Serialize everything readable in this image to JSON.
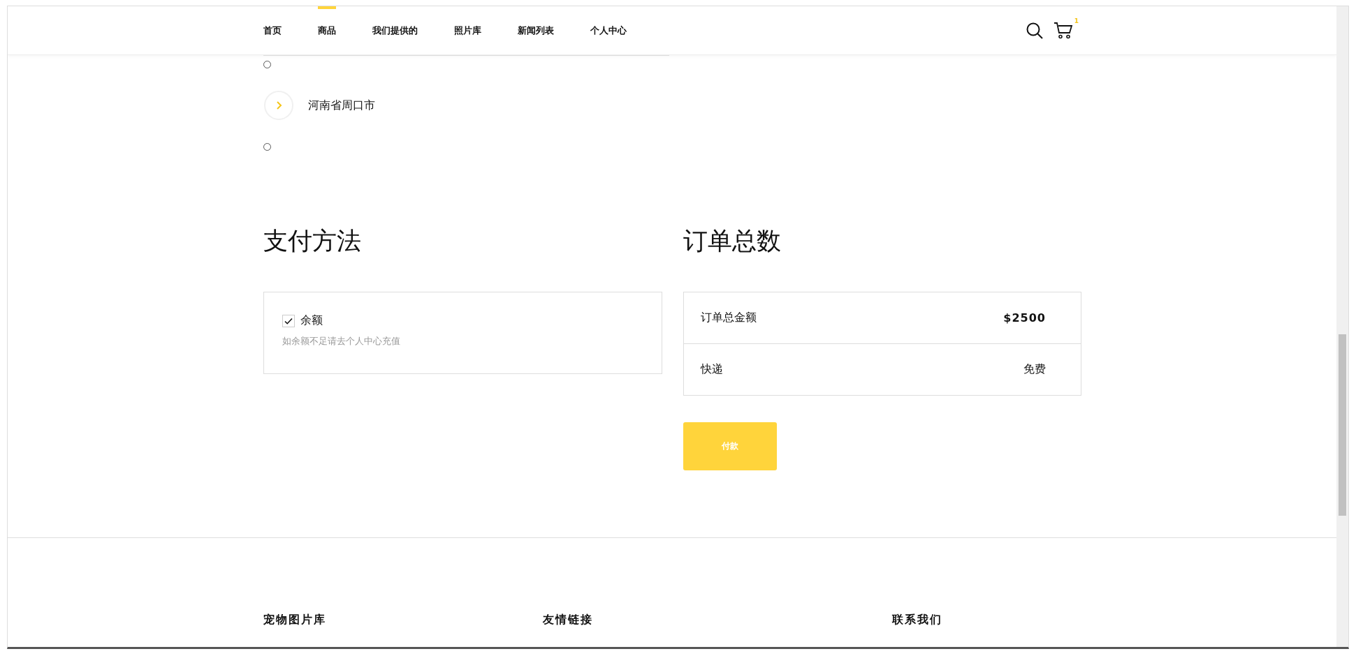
{
  "nav": {
    "items": [
      {
        "label": "首页",
        "selected": false
      },
      {
        "label": "商品",
        "selected": true
      },
      {
        "label": "我们提供的",
        "selected": false
      },
      {
        "label": "照片库",
        "selected": false
      },
      {
        "label": "新闻列表",
        "selected": false
      },
      {
        "label": "个人中心",
        "selected": false
      }
    ],
    "cart_count": "1"
  },
  "address_options": [
    {
      "kind": "radio",
      "selected": false
    },
    {
      "kind": "address",
      "text": "河南省周口市"
    },
    {
      "kind": "radio",
      "selected": false
    }
  ],
  "payment": {
    "title": "支付方法",
    "method": {
      "label": "余额",
      "checked": true
    },
    "note": "如余额不足请去个人中心充值"
  },
  "order": {
    "title": "订单总数",
    "rows": [
      {
        "label": "订单总金额",
        "value": "$2500",
        "bold": true
      },
      {
        "label": "快递",
        "value": "免费",
        "bold": false
      }
    ],
    "pay_button": "付款"
  },
  "footer": {
    "headings": [
      "宠物图片库",
      "友情链接",
      "联系我们"
    ]
  }
}
